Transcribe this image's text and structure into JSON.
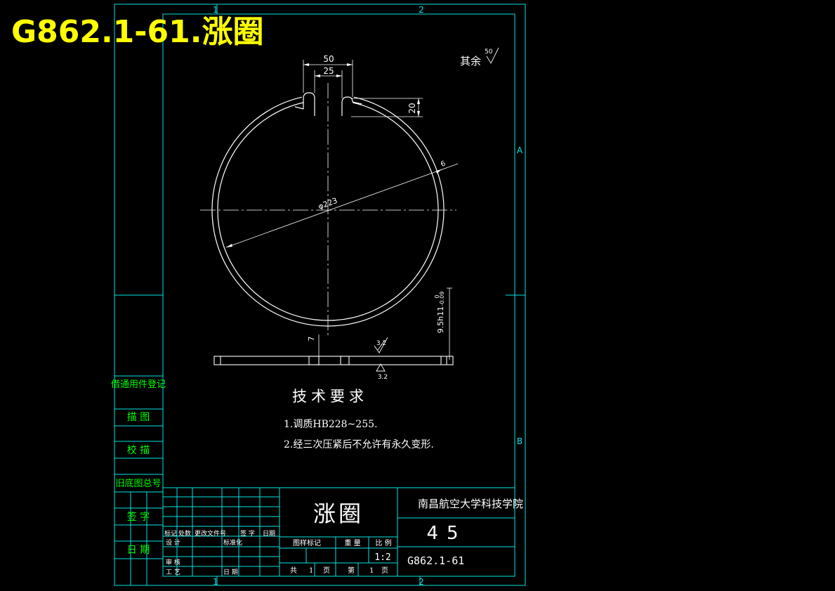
{
  "overlay_title": "G862.1-61.涨圈",
  "zone_marks": {
    "top_1": "1",
    "top_2": "2",
    "bottom_1": "1",
    "bottom_2": "2",
    "side_a": "A",
    "side_b": "B"
  },
  "roughness_note": {
    "label": "其余",
    "value": "50"
  },
  "dimensions": {
    "width_50": "50",
    "gap_25": "25",
    "height_20": "20",
    "diameter": "φ223",
    "radial_6": "6",
    "thickness": "9.5h11",
    "tol_upper": "0",
    "tol_lower": "-0.09",
    "slot_7": "7",
    "rough_top": "3.2",
    "rough_bottom": "3.2"
  },
  "tech_req": {
    "title": "技术要求",
    "items": [
      "1.调质HB228~255.",
      "2.经三次压紧后不允许有永久变形."
    ]
  },
  "left_strip": [
    "借通用件登记",
    "描 图",
    "校 描",
    "旧底图总号",
    "签 字",
    "日 期"
  ],
  "title_block": {
    "part_name": "涨圈",
    "institution": "南昌航空大学科技学院",
    "material": "45",
    "drawing_no": "G862.1-61",
    "scale": "1:2",
    "headers": {
      "mark": "标记",
      "count": "处数",
      "change_doc": "更改文件号",
      "sign": "签 字",
      "date": "日期"
    },
    "rows": {
      "design": "设 计",
      "standardize": "标准化",
      "review": "审 核",
      "process": "工 艺",
      "date_label": "日 期"
    },
    "cells": {
      "stage_mark": "图样标记",
      "weight": "重 量",
      "ratio": "比 例",
      "total": "共",
      "total_n": "1",
      "page": "页",
      "sheet": "第",
      "sheet_n": "1"
    }
  }
}
